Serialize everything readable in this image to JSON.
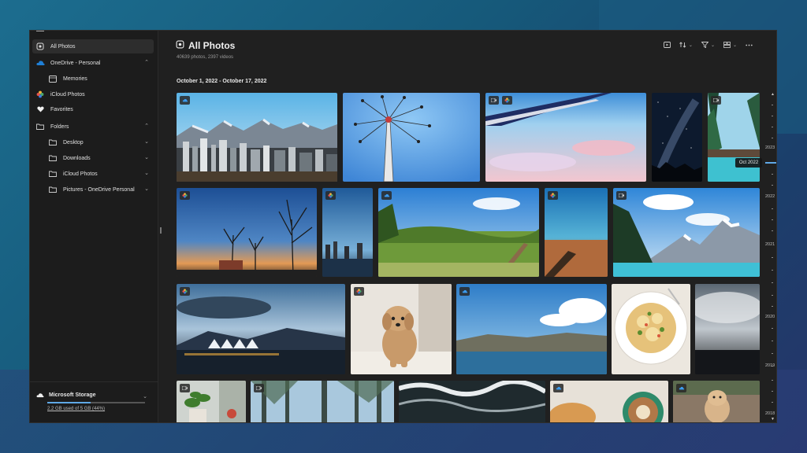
{
  "sidebar": {
    "items": [
      {
        "label": "All Photos",
        "icon": "photos-icon"
      },
      {
        "label": "OneDrive - Personal",
        "icon": "onedrive-icon"
      },
      {
        "label": "Memories",
        "icon": "memories-icon"
      },
      {
        "label": "iCloud Photos",
        "icon": "icloud-icon"
      },
      {
        "label": "Favorites",
        "icon": "heart-icon"
      },
      {
        "label": "Folders",
        "icon": "folder-icon"
      },
      {
        "label": "Desktop",
        "icon": "folder-icon"
      },
      {
        "label": "Downloads",
        "icon": "folder-icon"
      },
      {
        "label": "iCloud Photos",
        "icon": "folder-icon"
      },
      {
        "label": "Pictures - OneDrive Personal",
        "icon": "folder-icon"
      }
    ],
    "storage": {
      "title": "Microsoft Storage",
      "used_text": "2.2 GB used of 5 GB (44%)",
      "used_fraction": 0.44
    }
  },
  "header": {
    "title": "All Photos",
    "subtitle": "40639 photos, 2397 videos",
    "toolbar": [
      "slideshow-icon",
      "sort-icon",
      "filter-icon",
      "view-icon",
      "more-icon"
    ]
  },
  "main": {
    "date_range": "October 1, 2022 - October 17, 2022"
  },
  "timeline": {
    "years": [
      "2023",
      "2022",
      "2021",
      "2020",
      "2019",
      "2018"
    ],
    "current": "Oct 2022"
  },
  "colors": {
    "accent": "#5fa8e6",
    "onedrive_blue": "#1f7fd6",
    "window_bg": "#202020",
    "sidebar_bg": "#1c1c1c"
  }
}
